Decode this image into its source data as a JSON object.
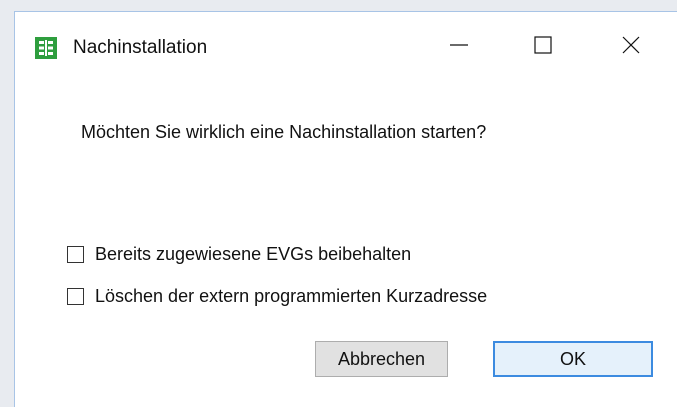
{
  "window": {
    "title": "Nachinstallation",
    "app_icon": "grid-app-icon",
    "accent_color": "#2e9e3e",
    "controls": {
      "minimize_icon": "minimize-icon",
      "maximize_icon": "maximize-icon",
      "close_icon": "close-icon"
    }
  },
  "dialog": {
    "message": "Möchten Sie wirklich eine Nachinstallation starten?",
    "options": [
      {
        "label": "Bereits zugewiesene EVGs beibehalten",
        "checked": false
      },
      {
        "label": "Löschen der extern programmierten Kurzadresse",
        "checked": false
      }
    ],
    "buttons": {
      "cancel_label": "Abbrechen",
      "ok_label": "OK",
      "default_button_color": "#3c8be0"
    }
  }
}
